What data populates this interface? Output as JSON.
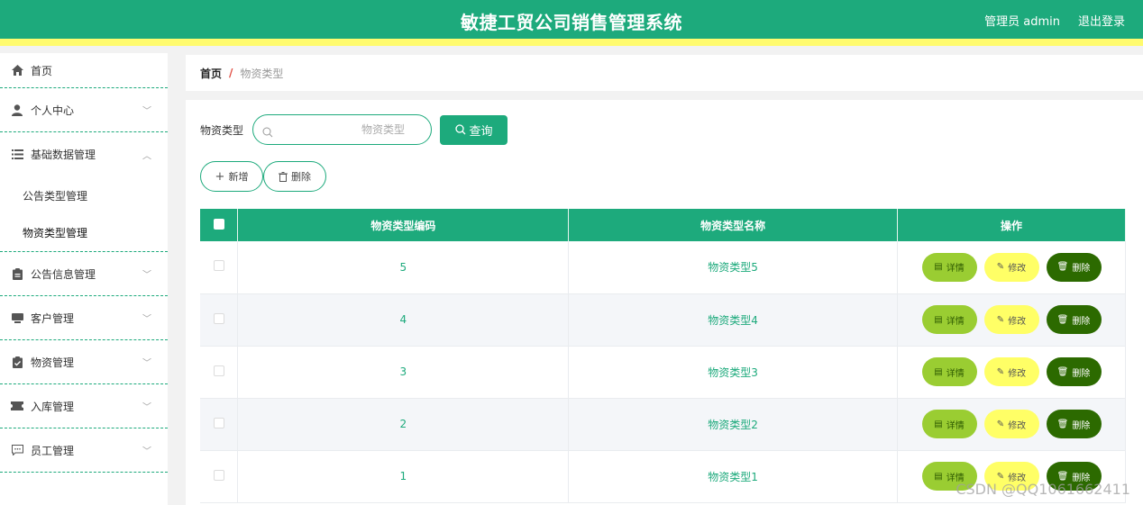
{
  "header": {
    "title": "敏捷工贸公司销售管理系统",
    "user": "管理员 admin",
    "logout": "退出登录"
  },
  "sidebar": {
    "home": "首页",
    "personal_center": "个人中心",
    "basic_data": "基础数据管理",
    "basic_sub": [
      "公告类型管理",
      "物资类型管理"
    ],
    "items": [
      "公告信息管理",
      "客户管理",
      "物资管理",
      "入库管理",
      "员工管理"
    ]
  },
  "breadcrumb": {
    "home": "首页",
    "separator": "/",
    "current": "物资类型"
  },
  "search": {
    "label": "物资类型",
    "placeholder": "物资类型",
    "button": "查询"
  },
  "actions": {
    "add": "新增",
    "delete": "删除"
  },
  "table": {
    "headers": [
      "物资类型编码",
      "物资类型名称",
      "操作"
    ],
    "rows": [
      {
        "code": "5",
        "name": "物资类型5"
      },
      {
        "code": "4",
        "name": "物资类型4"
      },
      {
        "code": "3",
        "name": "物资类型3"
      },
      {
        "code": "2",
        "name": "物资类型2"
      },
      {
        "code": "1",
        "name": "物资类型1"
      }
    ],
    "row_buttons": {
      "detail": "详情",
      "edit": "修改",
      "delete": "删除"
    }
  },
  "watermark": "CSDN @QQ1061662411",
  "colors": {
    "primary": "#1daa7c",
    "accent_strip": "#fffb6f",
    "detail_btn": "#9acd32",
    "edit_btn": "#ffff66",
    "delete_btn": "#2c6a00"
  }
}
